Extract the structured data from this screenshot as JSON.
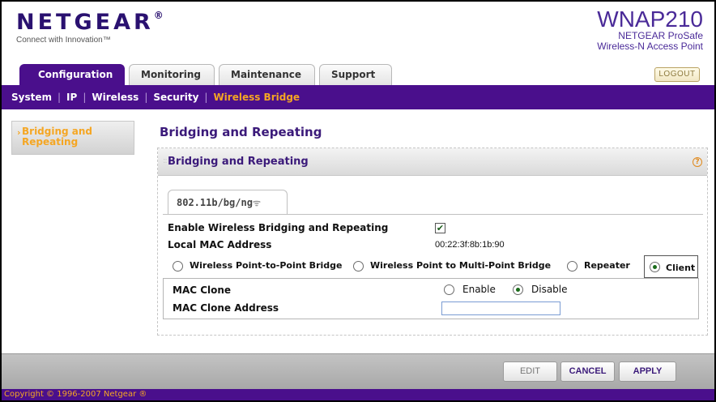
{
  "header": {
    "brand": "NETGEAR",
    "brand_mark": "®",
    "tagline": "Connect with Innovation™",
    "model": "WNAP210",
    "product_line1": "NETGEAR ProSafe",
    "product_line2": "Wireless-N Access Point",
    "logout_label": "LOGOUT"
  },
  "tabs": [
    {
      "label": "Configuration",
      "active": true
    },
    {
      "label": "Monitoring",
      "active": false
    },
    {
      "label": "Maintenance",
      "active": false
    },
    {
      "label": "Support",
      "active": false
    }
  ],
  "subnav": [
    {
      "label": "System"
    },
    {
      "label": "IP"
    },
    {
      "label": "Wireless"
    },
    {
      "label": "Security"
    },
    {
      "label": "Wireless Bridge",
      "active": true
    }
  ],
  "sidebar": {
    "arrow": "›",
    "item_label": "Bridging and Repeating"
  },
  "page_title": "Bridging and Repeating",
  "section": {
    "title": "Bridging and Repeating",
    "help": "?",
    "band_tab": "802.11b/bg/ng",
    "enable_label": "Enable Wireless Bridging and Repeating",
    "enable_checked": true,
    "mac_label": "Local MAC Address",
    "mac_value": "00:22:3f:8b:1b:90",
    "modes": [
      {
        "label": "Wireless Point-to-Point Bridge",
        "checked": false
      },
      {
        "label": "Wireless Point to Multi-Point Bridge",
        "checked": false
      },
      {
        "label": "Repeater",
        "checked": false
      },
      {
        "label": "Client",
        "checked": true
      }
    ],
    "mac_clone_label": "MAC Clone",
    "enable_opt": "Enable",
    "disable_opt": "Disable",
    "mac_clone_selected": "Disable",
    "mac_clone_address_label": "MAC Clone Address",
    "mac_clone_address_value": ""
  },
  "buttons": {
    "edit": "EDIT",
    "cancel": "CANCEL",
    "apply": "APPLY"
  },
  "footer": {
    "copyright": "Copyright © 1996-2007 Netgear ®"
  },
  "colors": {
    "brand_purple": "#4a0f8c",
    "accent_orange": "#f5a623"
  }
}
